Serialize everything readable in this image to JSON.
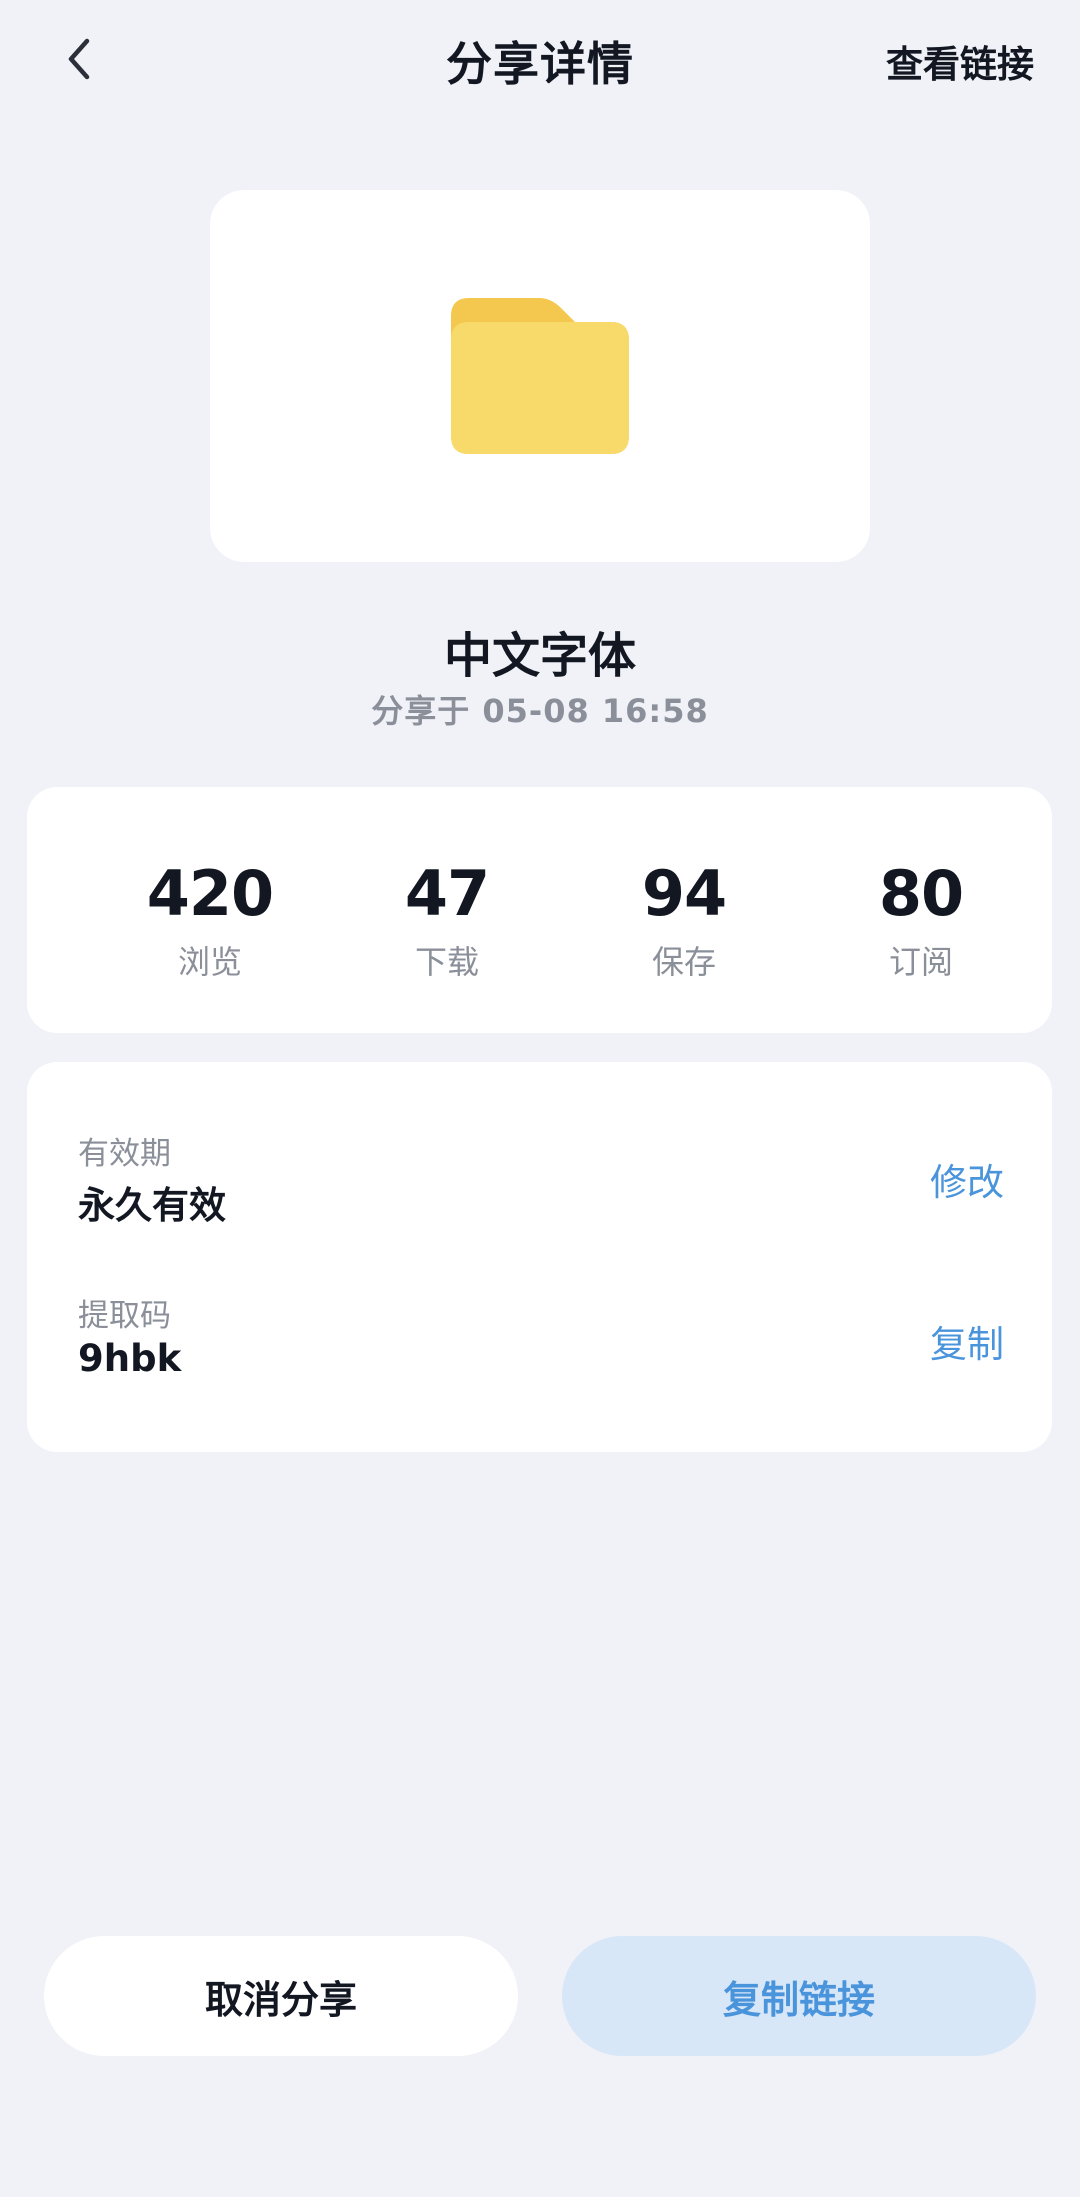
{
  "header": {
    "title": "分享详情",
    "right_action": "查看链接",
    "back_icon": "chevron-left-icon"
  },
  "file": {
    "icon": "folder-icon",
    "icon_colors": {
      "back": "#f4c84f",
      "front": "#f8da6b"
    },
    "name": "中文字体",
    "shared_at": "分享于 05-08 16:58"
  },
  "stats": [
    {
      "value": "420",
      "label": "浏览"
    },
    {
      "value": "47",
      "label": "下载"
    },
    {
      "value": "94",
      "label": "保存"
    },
    {
      "value": "80",
      "label": "订阅"
    }
  ],
  "info": {
    "validity": {
      "label": "有效期",
      "value": "永久有效",
      "action": "修改"
    },
    "code": {
      "label": "提取码",
      "value": "9hbk",
      "action": "复制"
    }
  },
  "actions": {
    "cancel": "取消分享",
    "copy_link": "复制链接"
  },
  "colors": {
    "background": "#f0f2f7",
    "accent": "#4a94dc",
    "accent_light": "#d8e7f7"
  }
}
